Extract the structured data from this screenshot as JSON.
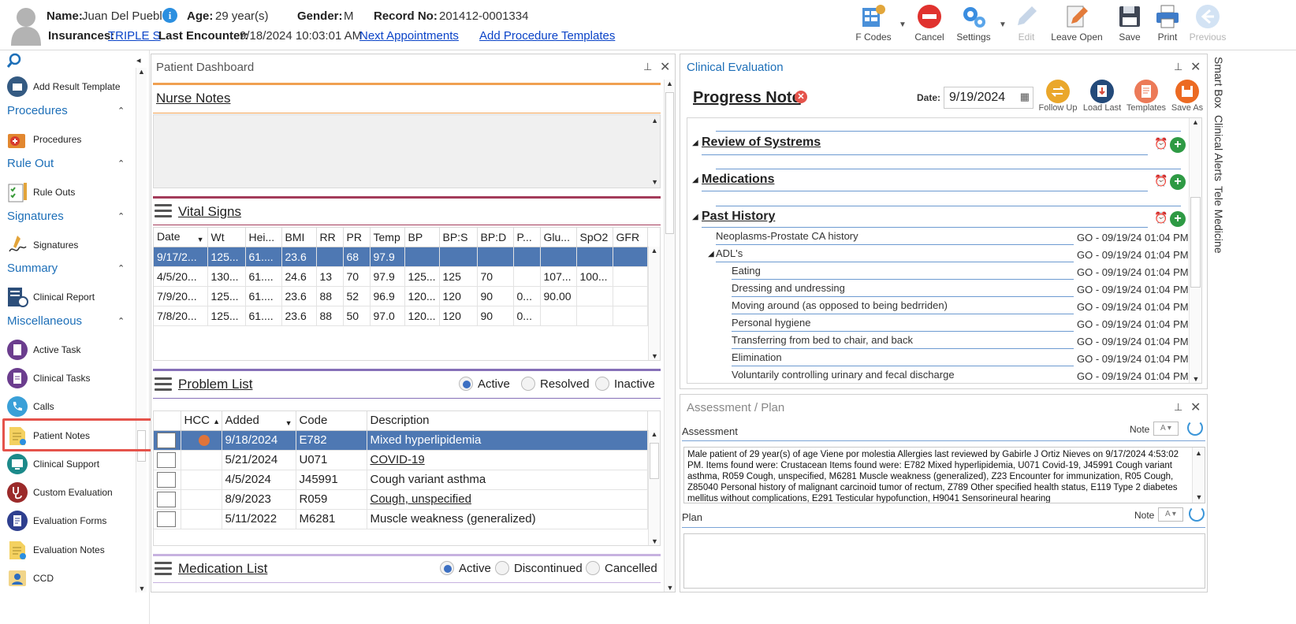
{
  "header": {
    "name_label": "Name:",
    "name": "Juan Del Pueblo",
    "age_label": "Age:",
    "age": "29 year(s)",
    "gender_label": "Gender:",
    "gender": "M",
    "record_label": "Record No:",
    "record": "201412-0001334",
    "insurance_label": "Insurances:",
    "insurance": "TRIPLE S",
    "last_encounter_label": "Last Encounter:",
    "last_encounter": "9/18/2024 10:03:01 AM",
    "next_appointments": "Next Appointments",
    "add_procedure_templates": "Add Procedure Templates"
  },
  "toolbar": {
    "fcodes": "F Codes",
    "cancel": "Cancel",
    "settings": "Settings",
    "edit": "Edit",
    "leave_open": "Leave Open",
    "save": "Save",
    "print": "Print",
    "previous": "Previous"
  },
  "sidebar": {
    "add_result_template": "Add Result Template",
    "groups": {
      "procedures": "Procedures",
      "rule_out": "Rule Out",
      "signatures": "Signatures",
      "summary": "Summary",
      "miscellaneous": "Miscellaneous"
    },
    "items": {
      "procedures": "Procedures",
      "rule_outs": "Rule Outs",
      "signatures": "Signatures",
      "clinical_report": "Clinical Report",
      "active_task": "Active Task",
      "clinical_tasks": "Clinical Tasks",
      "calls": "Calls",
      "patient_notes": "Patient Notes",
      "clinical_support": "Clinical Support",
      "custom_evaluation": "Custom Evaluation",
      "evaluation_forms": "Evaluation Forms",
      "evaluation_notes": "Evaluation Notes",
      "ccd": "CCD"
    }
  },
  "dashboard": {
    "title": "Patient Dashboard",
    "nurse_notes": "Nurse Notes",
    "vital_signs": "Vital Signs",
    "problem_list": "Problem List",
    "medication_list": "Medication List",
    "vitals": {
      "columns": [
        "Date",
        "Wt",
        "Hei...",
        "BMI",
        "RR",
        "PR",
        "Temp",
        "BP",
        "BP:S",
        "BP:D",
        "P...",
        "Glu...",
        "SpO2",
        "GFR"
      ],
      "rows": [
        [
          "9/17/2...",
          "125...",
          "61....",
          "23.6",
          "",
          "68",
          "97.9",
          "",
          "",
          "",
          "",
          "",
          "",
          ""
        ],
        [
          "4/5/20...",
          "130...",
          "61....",
          "24.6",
          "13",
          "70",
          "97.9",
          "125...",
          "125",
          "70",
          "",
          "107...",
          "100...",
          ""
        ],
        [
          "7/9/20...",
          "125...",
          "61....",
          "23.6",
          "88",
          "52",
          "96.9",
          "120...",
          "120",
          "90",
          "0...",
          "90.00",
          "",
          ""
        ],
        [
          "7/8/20...",
          "125...",
          "61....",
          "23.6",
          "88",
          "50",
          "97.0",
          "120...",
          "120",
          "90",
          "0...",
          "",
          "",
          ""
        ]
      ]
    },
    "problem_filters": {
      "active": "Active",
      "resolved": "Resolved",
      "inactive": "Inactive"
    },
    "problems": {
      "columns": [
        "HCC",
        "Added",
        "Code",
        "Description"
      ],
      "rows": [
        {
          "added": "9/18/2024",
          "code": "E782",
          "description": "Mixed hyperlipidemia"
        },
        {
          "added": "5/21/2024",
          "code": "U071",
          "description": "COVID-19"
        },
        {
          "added": "4/5/2024",
          "code": "J45991",
          "description": "Cough variant asthma"
        },
        {
          "added": "8/9/2023",
          "code": "R059",
          "description": "Cough, unspecified"
        },
        {
          "added": "5/11/2022",
          "code": "M6281",
          "description": "Muscle weakness (generalized)"
        }
      ]
    },
    "med_filters": {
      "active": "Active",
      "discontinued": "Discontinued",
      "cancelled": "Cancelled"
    }
  },
  "clinical_eval": {
    "title": "Clinical Evaluation",
    "note_title": "Progress Note",
    "date_label": "Date:",
    "date": "9/19/2024",
    "buttons": {
      "follow_up": "Follow Up",
      "load_last": "Load Last",
      "templates": "Templates",
      "save_as": "Save As"
    },
    "sections": {
      "ros": "Review of Systrems",
      "medications": "Medications",
      "past_history": "Past History"
    },
    "history": [
      {
        "label": "Neoplasms-Prostate CA history",
        "meta": "GO - 09/19/24 01:04 PM"
      },
      {
        "label": "ADL's",
        "meta": "GO - 09/19/24 01:04 PM"
      },
      {
        "label": "Eating",
        "meta": "GO - 09/19/24 01:04 PM"
      },
      {
        "label": "Dressing and undressing",
        "meta": "GO - 09/19/24 01:04 PM"
      },
      {
        "label": "Moving around (as opposed to being bedrriden)",
        "meta": "GO - 09/19/24 01:04 PM"
      },
      {
        "label": "Personal hygiene",
        "meta": "GO - 09/19/24 01:04 PM"
      },
      {
        "label": "Transferring from bed to chair, and back",
        "meta": "GO - 09/19/24 01:04 PM"
      },
      {
        "label": "Elimination",
        "meta": "GO - 09/19/24 01:04 PM"
      },
      {
        "label": "Voluntarily controlling urinary and fecal discharge",
        "meta": "GO - 09/19/24 01:04 PM"
      }
    ]
  },
  "assessment_plan": {
    "title": "Assessment / Plan",
    "assessment_label": "Assessment",
    "note_label": "Note",
    "assessment_text": "Male patient of 29 year(s) of age Viene por molestia     Allergies last reviewed by Gabirle J Ortiz Nieves on 9/17/2024 4:53:02 PM.    Items found were:  Crustacean  Items found were:  E782 Mixed hyperlipidemia, U071 Covid-19, J45991 Cough variant asthma, R059 Cough, unspecified, M6281 Muscle weakness (generalized), Z23 Encounter for immunization, R05 Cough, Z85040 Personal history of malignant carcinoid tumor of rectum, Z789 Other specified health status, E119 Type 2 diabetes mellitus without complications, E291 Testicular hypofunction, H9041 Sensorineural hearing",
    "plan_label": "Plan"
  },
  "side_tabs": {
    "smart_box": "Smart Box",
    "clinical_alerts": "Clinical Alerts",
    "tele_medicine": "Tele Medicine"
  },
  "colors": {
    "accent_blue": "#1d6fb8",
    "selected_row": "#4e78b3",
    "highlight_red": "#e5534b",
    "orange_rule": "#f0a050",
    "maroon_rule": "#a33b5a",
    "purple_rule": "#8670b8"
  }
}
